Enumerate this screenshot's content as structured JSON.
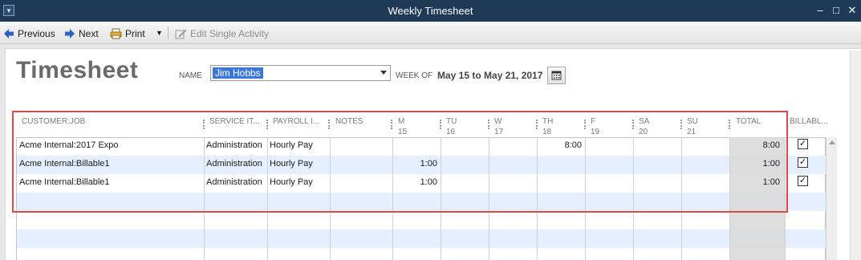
{
  "window": {
    "title": "Weekly Timesheet",
    "controls": {
      "sysmenu": "▾",
      "minimize": "–",
      "maximize": "□",
      "close": "✕"
    }
  },
  "toolbar": {
    "previous": "Previous",
    "next": "Next",
    "print": "Print",
    "print_dropdown": "▼",
    "edit_single": "Edit Single Activity"
  },
  "form": {
    "page_title": "Timesheet",
    "name_label": "NAME",
    "name_value": "Jim  Hobbs",
    "week_label": "WEEK OF",
    "week_value": "May 15 to May 21, 2017"
  },
  "grid": {
    "headers": {
      "customer_job": "CUSTOMER:JOB",
      "service_item": "SERVICE IT...",
      "payroll_item": "PAYROLL I...",
      "notes": "NOTES",
      "mon": "M",
      "mon_date": "15",
      "tue": "TU",
      "tue_date": "16",
      "wed": "W",
      "wed_date": "17",
      "thu": "TH",
      "thu_date": "18",
      "fri": "F",
      "fri_date": "19",
      "sat": "SA",
      "sat_date": "20",
      "sun": "SU",
      "sun_date": "21",
      "total": "TOTAL",
      "billable": "BILLABL..."
    },
    "rows": [
      {
        "customer_job": "Acme Internal:2017 Expo",
        "service_item": "Administration",
        "payroll_item": "Hourly Pay",
        "notes": "",
        "mon": "",
        "tue": "",
        "wed": "",
        "thu": "8:00",
        "fri": "",
        "sat": "",
        "sun": "",
        "total": "8:00",
        "billable": "✓"
      },
      {
        "customer_job": "Acme Internal:Billable1",
        "service_item": "Administration",
        "payroll_item": "Hourly Pay",
        "notes": "",
        "mon": "1:00",
        "tue": "",
        "wed": "",
        "thu": "",
        "fri": "",
        "sat": "",
        "sun": "",
        "total": "1:00",
        "billable": "✓"
      },
      {
        "customer_job": "Acme Internal:Billable1",
        "service_item": "Administration",
        "payroll_item": "Hourly Pay",
        "notes": "",
        "mon": "1:00",
        "tue": "",
        "wed": "",
        "thu": "",
        "fri": "",
        "sat": "",
        "sun": "",
        "total": "1:00",
        "billable": "✓"
      }
    ]
  },
  "colors": {
    "titlebar": "#1f3a57",
    "selection": "#3b78d6",
    "row_alt": "#e5efff",
    "highlight": "#d94b4b"
  }
}
